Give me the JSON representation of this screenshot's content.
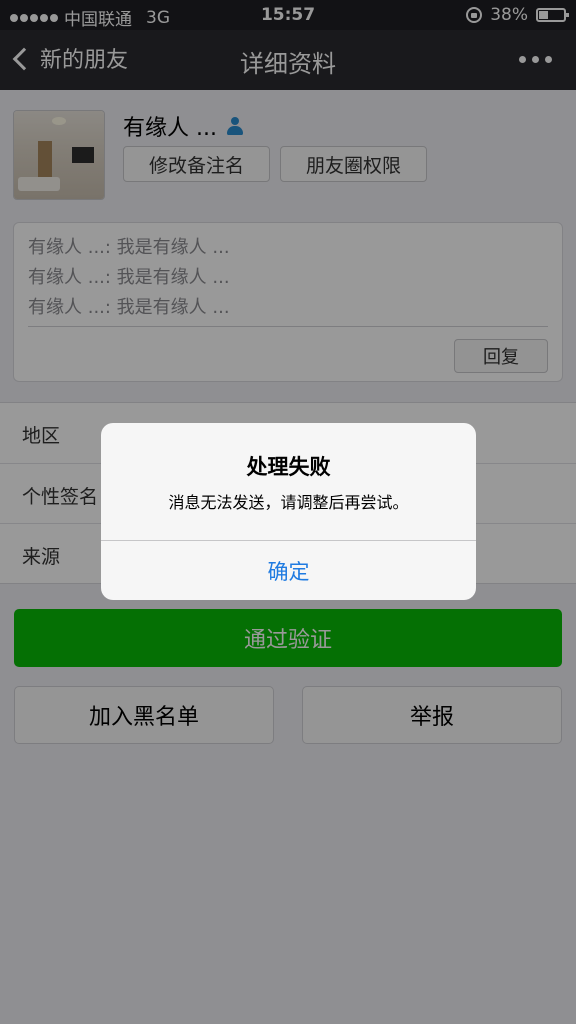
{
  "status_bar": {
    "carrier": "中国联通",
    "network": "3G",
    "time": "15:57",
    "battery_percent": "38%",
    "battery_level": 0.38
  },
  "nav": {
    "back_label": "新的朋友",
    "title": "详细资料"
  },
  "profile": {
    "name": "有缘人 ...",
    "remark_button": "修改备注名",
    "moments_button": "朋友圈权限"
  },
  "messages": {
    "lines": [
      "有缘人 ...: 我是有缘人 ...",
      "有缘人 ...: 我是有缘人 ...",
      "有缘人 ...: 我是有缘人 ..."
    ],
    "reply_button": "回复"
  },
  "info": {
    "rows": [
      {
        "label": "地区"
      },
      {
        "label": "个性签名"
      },
      {
        "label": "来源"
      }
    ]
  },
  "actions": {
    "verify_button": "通过验证",
    "blacklist_button": "加入黑名单",
    "report_button": "举报"
  },
  "dialog": {
    "title": "处理失败",
    "message": "消息无法发送，请调整后再尝试。",
    "ok_button": "确定"
  },
  "colors": {
    "accent_green": "#09bb07",
    "link_blue": "#1f7be1",
    "nav_bg": "#2b2b30"
  }
}
